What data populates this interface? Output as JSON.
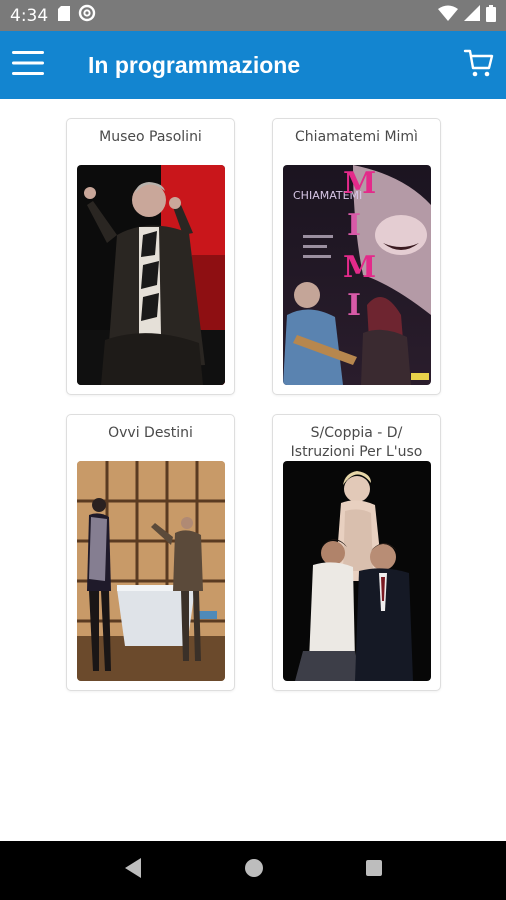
{
  "status_bar": {
    "time": "4:34",
    "icons": [
      "sd-card-icon",
      "data-saver-icon",
      "wifi-icon",
      "signal-icon",
      "battery-icon"
    ]
  },
  "app_bar": {
    "title": "In programmazione",
    "menu_icon": "hamburger-menu-icon",
    "cart_icon": "cart-icon",
    "color": "#1385d0"
  },
  "shows": [
    {
      "title": "Museo Pasolini",
      "poster": "photo of an actor in a dark suit gesturing on stage with red background"
    },
    {
      "title": "Chiamatemi Mimì",
      "poster": "poster with a singing woman and a man playing guitar"
    },
    {
      "title": "Ovvi Destini",
      "poster": "stage scene with actors in front of a wooden grid set"
    },
    {
      "title": "S/Coppia - D/ Istruzioni Per L'uso",
      "poster": "three actors posing against a black background"
    }
  ],
  "nav_bar": {
    "icons": [
      "back-icon",
      "home-icon",
      "recents-icon"
    ]
  }
}
